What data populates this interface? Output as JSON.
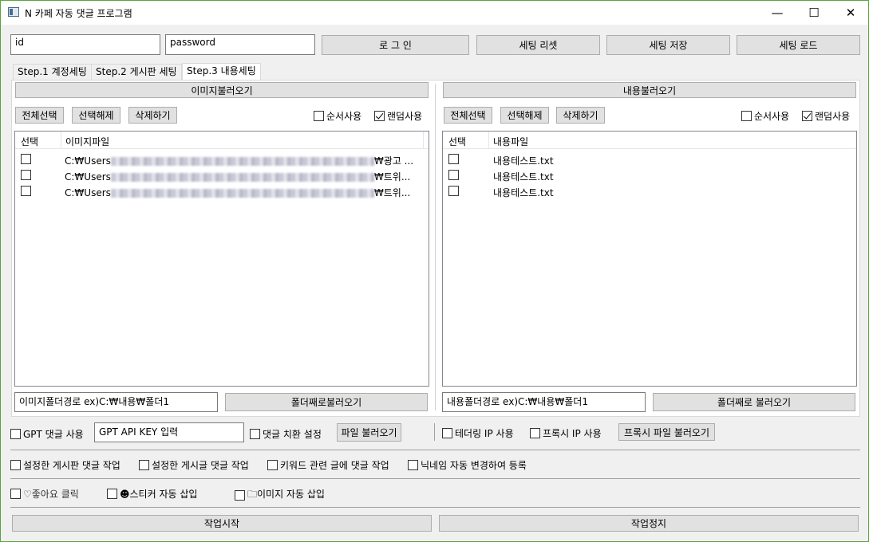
{
  "window": {
    "title": "N 카페 자동 댓글 프로그램",
    "minimize": "—",
    "maximize": "☐",
    "close": "✕"
  },
  "login": {
    "id_value": "id",
    "password_value": "password",
    "login_button": "로 그 인",
    "reset_button": "세팅 리셋",
    "save_button": "세팅 저장",
    "load_button": "세팅 로드"
  },
  "tabs": [
    {
      "label": "Step.1 계정세팅"
    },
    {
      "label": "Step.2 게시판 세팅"
    },
    {
      "label": "Step.3 내용세팅"
    }
  ],
  "image_panel": {
    "load_button": "이미지불러오기",
    "select_all": "전체선택",
    "deselect": "선택해제",
    "delete": "삭제하기",
    "order_use": "순서사용",
    "random_use": "랜덤사용",
    "col_select": "선택",
    "col_file": "이미지파일",
    "rows": [
      {
        "prefix": "C:₩Users",
        "suffix": "₩광고 ..."
      },
      {
        "prefix": "C:₩Users",
        "suffix": "₩트위..."
      },
      {
        "prefix": "C:₩Users",
        "suffix": "₩트위..."
      }
    ],
    "folder_path": "이미지폴더경로 ex)C:₩내용₩폴더1",
    "folder_button": "폴더째로불러오기"
  },
  "content_panel": {
    "load_button": "내용불러오기",
    "select_all": "전체선택",
    "deselect": "선택해제",
    "delete": "삭제하기",
    "order_use": "순서사용",
    "random_use": "랜덤사용",
    "col_select": "선택",
    "col_file": "내용파일",
    "rows": [
      {
        "file": "내용테스트.txt"
      },
      {
        "file": "내용테스트.txt"
      },
      {
        "file": "내용테스트.txt"
      }
    ],
    "folder_path": "내용폴더경로 ex)C:₩내용₩폴더1",
    "folder_button": "폴더째로 불러오기"
  },
  "options": {
    "gpt_use": "GPT 댓글 사용",
    "gpt_key": "GPT API KEY 입력",
    "replace_setting": "댓글 치환 설정",
    "file_load": "파일 불러오기",
    "tethering": "테더링 IP 사용",
    "proxy": "프록시 IP 사용",
    "proxy_file": "프록시 파일 불러오기",
    "board_comment": "설정한 게시판 댓글 작업",
    "post_comment": "설정한 게시글 댓글 작업",
    "keyword_comment": "키워드 관련 글에 댓글 작업",
    "nickname_change": "닉네임 자동 변경하여 등록",
    "like_click": "♡좋아요 클릭",
    "sticker_insert": "☻스티커 자동 삽입",
    "image_insert": "🗀이미지 자동 삽입"
  },
  "actions": {
    "start": "작업시작",
    "stop": "작업정지"
  }
}
